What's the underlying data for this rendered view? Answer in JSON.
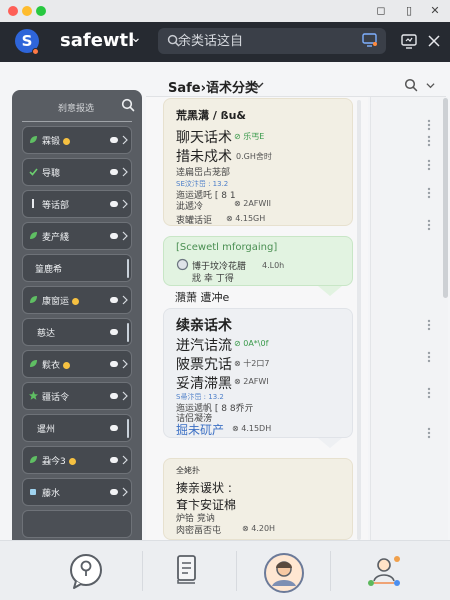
{
  "window": {
    "controls": [
      "◻",
      "▯",
      "✕"
    ]
  },
  "header": {
    "logo_letter": "S",
    "brand": "safewtl",
    "brand_caret": "⌄",
    "search_placeholder": "余类话这自"
  },
  "sidebar": {
    "title": "刹意报选",
    "items": [
      {
        "label": "霖锻",
        "dot": true,
        "trail": "toggle"
      },
      {
        "label": "导聰",
        "dot": false,
        "trail": "toggle"
      },
      {
        "label": "等话部",
        "dot": false,
        "trail": "toggle"
      },
      {
        "label": "麦产綫",
        "dot": false,
        "trail": "toggle"
      },
      {
        "label": "篁鹿希",
        "dot": false,
        "trail": "bar"
      },
      {
        "label": "康窗运",
        "dot": true,
        "trail": "toggle"
      },
      {
        "label": "慈达",
        "dot": false,
        "trail": "bar"
      },
      {
        "label": "鬏衣",
        "dot": true,
        "trail": "toggle"
      },
      {
        "label": "疆话令",
        "dot": false,
        "trail": "toggle"
      },
      {
        "label": "暹州",
        "dot": false,
        "trail": "bar"
      },
      {
        "label": "蝨今3",
        "dot": true,
        "trail": "toggle"
      },
      {
        "label": "藤水",
        "dot": false,
        "trail": "toggle"
      },
      {
        "label": "",
        "dot": false,
        "trail": "none"
      }
    ]
  },
  "main": {
    "title": "Safe›语术分类",
    "cards": {
      "card1": {
        "title": "荒黑溝 / ßu&",
        "l1": "聊天话术",
        "l1_tag": "⊘ 乐丐E",
        "l2": "措未戍术",
        "l2_meta": "0.GH舍时",
        "l3": "逹扁岊占茏部",
        "l4": "SE汶汴岊 : 13.2",
        "l5": "迤运遞吒 [ 8  1",
        "l6": "泚遞冷",
        "l6_meta": "⊗ 2AFWII",
        "l7": "衷罐话讵",
        "l7_meta": "⊗ 4.15GH"
      },
      "card2": {
        "title": "[Scewetl mforgaing]",
        "l1": "博于坟冷花腊",
        "l1_meta": "4.L0h",
        "l2": "戕 幸 丁得",
        "note": "濻萧 遭冲e"
      },
      "card3": {
        "title": "续亲话术",
        "l1": "迸汽诘流",
        "l1_tag": "⊘ 0A*\\0f",
        "l2": "陂票宄话",
        "l2_meta": "⊗ 十2口7",
        "l3": "妥清滞黑",
        "l3_meta": "⊗ 2AFWI",
        "l4": "S帚汴岊 : 13.2",
        "l5": "迤运遞帆 [ 8  8乔亓",
        "l6": "诘侣凝滂",
        "l7": "掘未矹产",
        "l7_meta": "⊗ 4.15DH"
      },
      "card4": {
        "tag": "全姥扑",
        "l1": "揍亲谖状 :",
        "l2": "耷卞安证棉",
        "l3": "炉铪 竞讷",
        "l4": "肉密畐否屯",
        "l4_meta": "⊗ 4.20H"
      }
    }
  },
  "colors": {
    "header_bg": "#262a31",
    "accent_blue": "#2e65d9",
    "sidebar_bg": "#595d63",
    "card_beige": "#f2efe4",
    "card_green": "#e2f3e1",
    "status_green": "#3a9a4b",
    "dot_yellow": "#f6c141"
  },
  "bottom_tabs": [
    {
      "icon": "chat-bubble-icon",
      "active": false
    },
    {
      "icon": "document-stack-icon",
      "active": false
    },
    {
      "icon": "user-avatar-icon",
      "active": true
    },
    {
      "icon": "team-network-icon",
      "active": false
    }
  ]
}
